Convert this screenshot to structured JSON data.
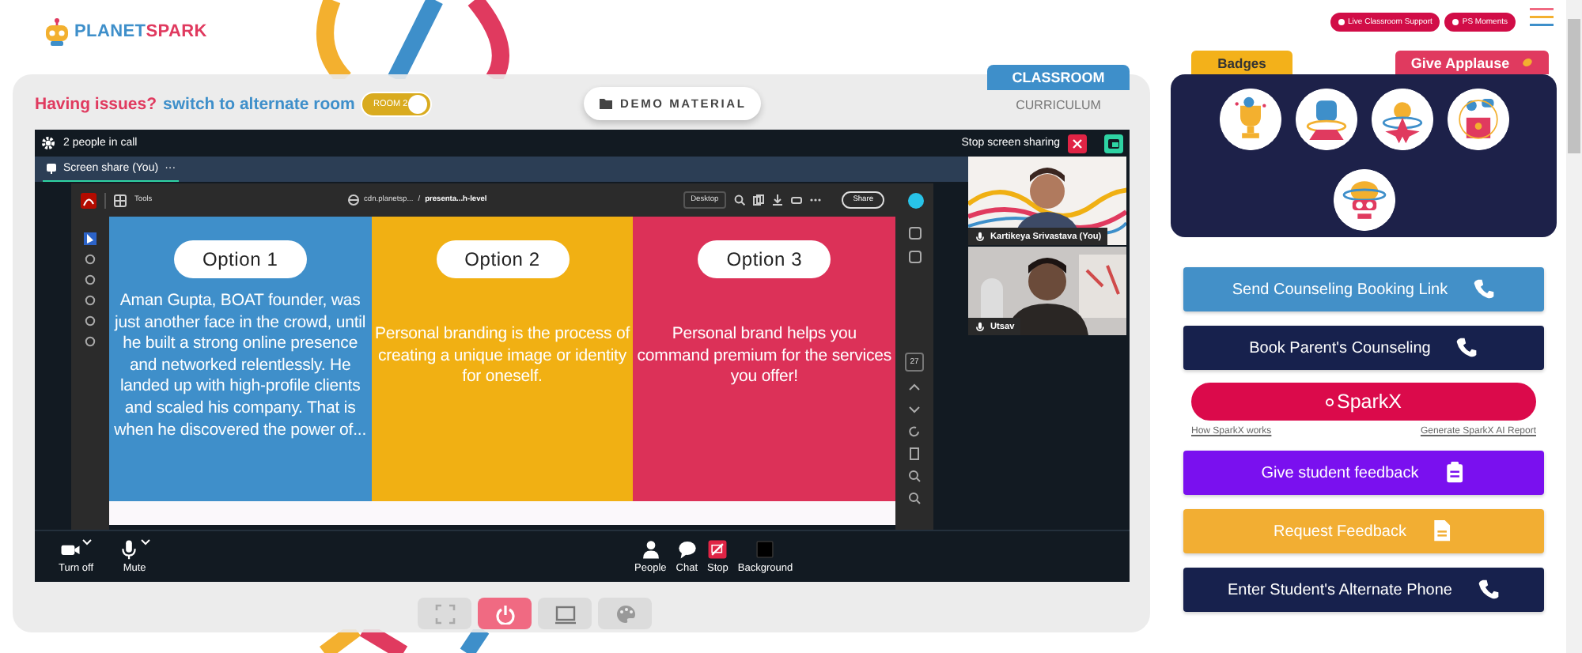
{
  "header": {
    "logo_left": "PLANET",
    "logo_right": "SPARK"
  },
  "top_links": [
    "Live Classroom Support",
    "PS Moments"
  ],
  "room_switch": {
    "issue": "Having issues?",
    "link": "switch to alternate room",
    "toggle_label": "ROOM 2",
    "on": true
  },
  "demo_button": "DEMO MATERIAL",
  "view_tabs": [
    {
      "label": "CLASSROOM",
      "selected": true
    },
    {
      "label": "CURRICULUM",
      "selected": false
    }
  ],
  "call": {
    "people": "2 people in call",
    "stop_sharing": "Stop screen sharing",
    "share_tab": "Screen share (You)",
    "more": "···",
    "viewer": {
      "tools": "Tools",
      "path_1": "cdn.planetsp...",
      "separator": "/",
      "path_2": "presenta...h-level",
      "desktop": "Desktop",
      "share": "Share",
      "page_number": "27"
    },
    "options": [
      {
        "title": "Option 1",
        "text": "Aman Gupta, BOAT founder, was just another face in the crowd, until he built a strong online presence and networked relentlessly. He landed up with high-profile clients and scaled his company. That is when he discovered the power of...",
        "color": "#3f8fca"
      },
      {
        "title": "Option 2",
        "text": "Personal branding is the process of creating a unique image or identity for oneself.",
        "color": "#f1b013"
      },
      {
        "title": "Option 3",
        "text": "Personal brand helps you command premium for the services you offer!",
        "color": "#dc3158"
      }
    ],
    "participants": [
      {
        "name": "Kartikeya Srivastava (You)"
      },
      {
        "name": "Utsav"
      }
    ],
    "controls": [
      {
        "label": "Turn off",
        "kind": "camera"
      },
      {
        "label": "Mute",
        "kind": "mic"
      },
      {
        "label": "People",
        "kind": "people"
      },
      {
        "label": "Chat",
        "kind": "chat"
      },
      {
        "label": "Stop",
        "kind": "stop"
      },
      {
        "label": "Background",
        "kind": "background"
      }
    ]
  },
  "stage_tools": [
    {
      "kind": "fullscreen",
      "selected": false
    },
    {
      "kind": "power",
      "selected": true
    },
    {
      "kind": "screen",
      "selected": false
    },
    {
      "kind": "palette",
      "selected": false
    }
  ],
  "side_tabs": {
    "badges": "Badges",
    "applause": "Give Applause"
  },
  "badges": [
    {
      "kind": "trophy"
    },
    {
      "kind": "fist"
    },
    {
      "kind": "star"
    },
    {
      "kind": "podium"
    },
    {
      "kind": "brain"
    }
  ],
  "actions": [
    {
      "label": "Send Counseling Booking Link",
      "kind": "phone",
      "color": "#4390c8"
    },
    {
      "label": "Book Parent's Counseling",
      "kind": "phone",
      "color": "#17214d"
    }
  ],
  "sparkx": {
    "label": "SparkX",
    "links": [
      "How SparkX works",
      "Generate SparkX AI Report"
    ]
  },
  "more_actions": [
    {
      "label": "Give student feedback",
      "kind": "clipboard",
      "color": "#7a10ef"
    },
    {
      "label": "Request Feedback",
      "kind": "document",
      "color": "#f2ae33"
    },
    {
      "label": "Enter Student's Alternate Phone",
      "kind": "phone",
      "color": "#17214d"
    }
  ]
}
